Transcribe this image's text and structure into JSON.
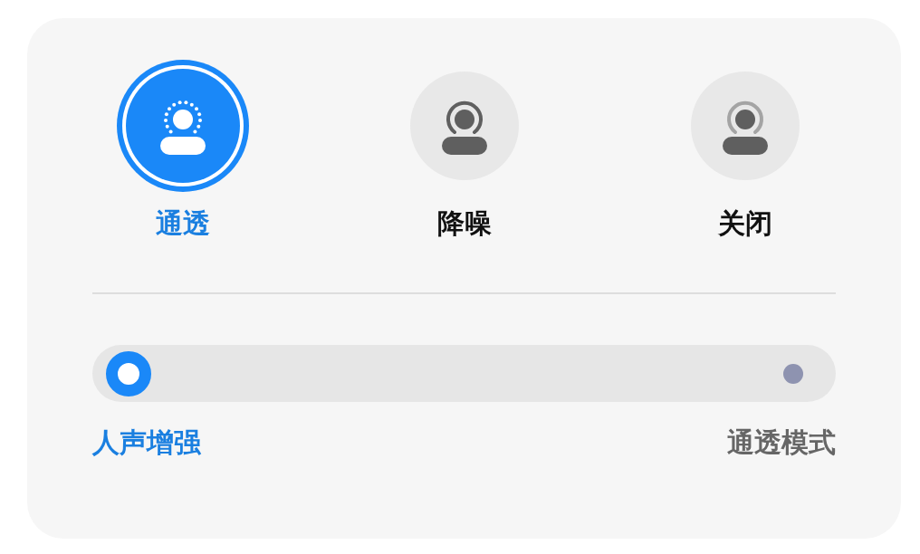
{
  "modes": [
    {
      "label": "通透",
      "kind": "transparency",
      "selected": true
    },
    {
      "label": "降噪",
      "kind": "noise-cancel",
      "selected": false
    },
    {
      "label": "关闭",
      "kind": "off",
      "selected": false
    }
  ],
  "transparency_slider": {
    "options": [
      {
        "label": "人声增强",
        "selected": true
      },
      {
        "label": "通透模式",
        "selected": false
      }
    ]
  }
}
